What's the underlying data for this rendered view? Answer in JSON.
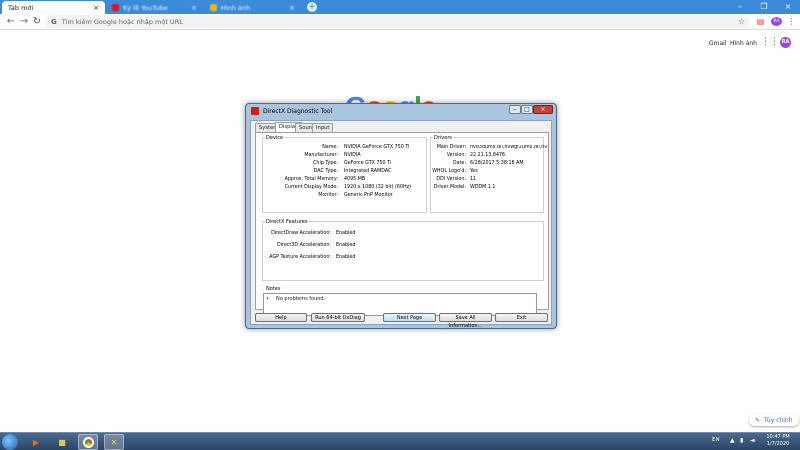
{
  "browser": {
    "tabs": [
      {
        "label": "Tab mới",
        "active": true
      },
      {
        "label": "Kỳ lễ YouTube",
        "active": false
      },
      {
        "label": "Hình ảnh",
        "active": false
      }
    ],
    "omnibox_placeholder": "Tìm kiếm Google hoặc nhập một URL",
    "profile_initials": "RA",
    "new_tab_symbol": "+"
  },
  "google": {
    "gmail": "Gmail",
    "images": "Hình ảnh",
    "logo": [
      "G",
      "o",
      "o",
      "g",
      "l",
      "e"
    ],
    "customize": "Tùy chỉnh",
    "avatar": "RA"
  },
  "dxdiag": {
    "title": "DirectX Diagnostic Tool",
    "tabs": [
      "System",
      "Display",
      "Sound",
      "Input"
    ],
    "selected_tab": "Display",
    "device": {
      "label": "Device",
      "fields": [
        {
          "k": "Name:",
          "v": "NVIDIA GeForce GTX 750 Ti"
        },
        {
          "k": "Manufacturer:",
          "v": "NVIDIA"
        },
        {
          "k": "Chip Type:",
          "v": "GeForce GTX 750 Ti"
        },
        {
          "k": "DAC Type:",
          "v": "Integrated RAMDAC"
        },
        {
          "k": "Approx. Total Memory:",
          "v": "4095 MB"
        },
        {
          "k": "Current Display Mode:",
          "v": "1920 x 1080 (32 bit) (60Hz)"
        },
        {
          "k": "Monitor:",
          "v": "Generic PnP Monitor"
        }
      ]
    },
    "drivers": {
      "label": "Drivers",
      "fields": [
        {
          "k": "Main Driver:",
          "v": "nvd3dumx.dll,nvwgf2umx.dll,nvwgf2"
        },
        {
          "k": "Version:",
          "v": "22.21.13.8476"
        },
        {
          "k": "Date:",
          "v": "6/28/2017 5:38:18 AM"
        },
        {
          "k": "WHQL Logo'd:",
          "v": "Yes"
        },
        {
          "k": "DDI Version:",
          "v": "11"
        },
        {
          "k": "Driver Model:",
          "v": "WDDM 1.1"
        }
      ]
    },
    "features": {
      "label": "DirectX Features",
      "fields": [
        {
          "k": "DirectDraw Acceleration:",
          "v": "Enabled"
        },
        {
          "k": "Direct3D Acceleration:",
          "v": "Enabled"
        },
        {
          "k": "AGP Texture Acceleration:",
          "v": "Enabled"
        }
      ]
    },
    "notes": {
      "label": "Notes",
      "text": "No problems found."
    },
    "buttons": {
      "help": "Help",
      "run64": "Run 64-bit DxDiag",
      "next": "Next Page",
      "save": "Save All Information...",
      "exit": "Exit"
    }
  },
  "taskbar": {
    "lang": "EN",
    "time": "10:47 PM",
    "date": "1/7/2020"
  }
}
